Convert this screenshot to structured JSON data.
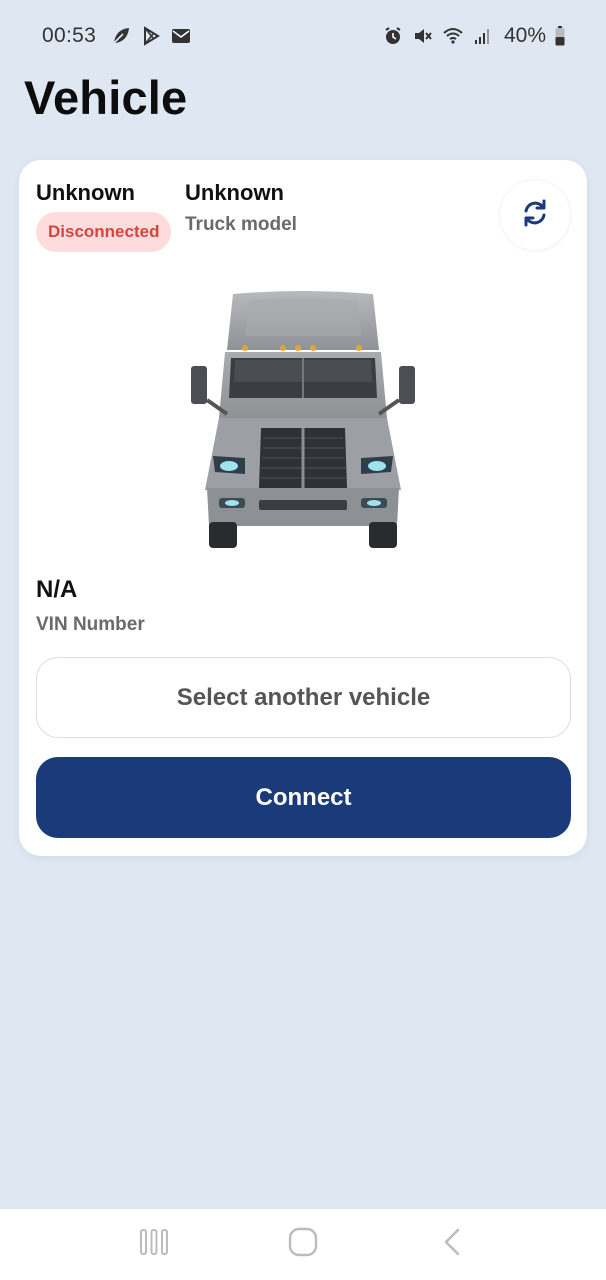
{
  "status_bar": {
    "time": "00:53",
    "battery": "40%",
    "icons_left": [
      "leaf-icon",
      "play-store-icon",
      "mail-icon"
    ],
    "icons_right": [
      "alarm-icon",
      "mute-icon",
      "wifi-icon",
      "signal-icon",
      "battery-icon"
    ]
  },
  "page": {
    "title": "Vehicle"
  },
  "vehicle": {
    "name": "Unknown",
    "status": "Disconnected",
    "model": "Unknown",
    "model_label": "Truck model",
    "vin": "N/A",
    "vin_label": "VIN Number"
  },
  "actions": {
    "select_label": "Select another vehicle",
    "connect_label": "Connect",
    "refresh_icon": "refresh-icon"
  },
  "colors": {
    "background": "#dee7f2",
    "primary": "#1b3a7a",
    "badge_bg": "#fcdcdc",
    "badge_text": "#d6453d"
  },
  "nav": {
    "recent_icon": "recent-apps-icon",
    "home_icon": "home-icon",
    "back_icon": "back-icon"
  }
}
